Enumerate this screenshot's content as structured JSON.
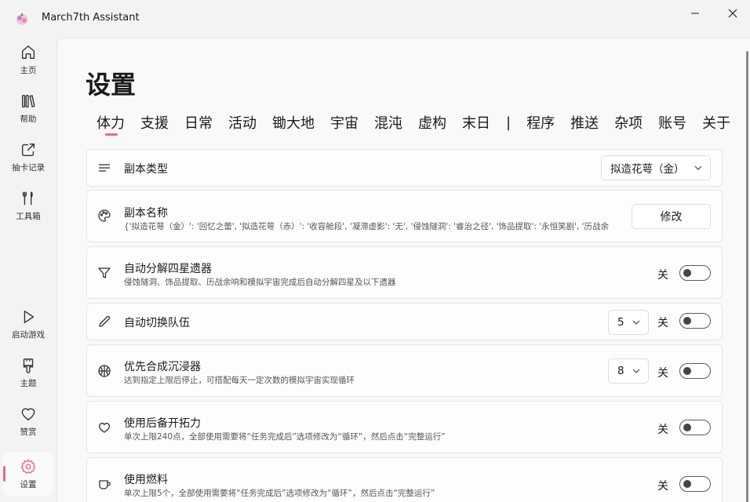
{
  "window": {
    "title": "March7th Assistant"
  },
  "sidebar": {
    "items": [
      {
        "label": "主页",
        "icon": "home-icon"
      },
      {
        "label": "帮助",
        "icon": "library-icon"
      },
      {
        "label": "抽卡记录",
        "icon": "share-icon"
      },
      {
        "label": "工具箱",
        "icon": "tools-icon"
      },
      {
        "label": "启动游戏",
        "icon": "play-icon"
      },
      {
        "label": "主题",
        "icon": "brush-icon"
      },
      {
        "label": "赞赏",
        "icon": "heart-icon"
      },
      {
        "label": "设置",
        "icon": "gear-icon",
        "active": true
      }
    ]
  },
  "page": {
    "title": "设置"
  },
  "tabs": [
    "体力",
    "支援",
    "日常",
    "活动",
    "锄大地",
    "宇宙",
    "混沌",
    "虚构",
    "末日",
    "|",
    "程序",
    "推送",
    "杂项",
    "账号",
    "关于"
  ],
  "cards": {
    "instance_type": {
      "title": "副本类型",
      "value": "拟造花萼（金）"
    },
    "instance_name": {
      "title": "副本名称",
      "desc": "{'拟造花萼（金）': '回忆之蕾', '拟造花萼（赤）': '收容舱段', '凝滞虚影': '无', '侵蚀隧洞': '睿治之径', '饰品提取': '永恒笑剧', '历战余",
      "button": "修改"
    },
    "auto_decompose": {
      "title": "自动分解四星遗器",
      "desc": "侵蚀隧洞、饰品提取、历战余响和模拟宇宙完成后自动分解四星及以下遗器",
      "state": "关"
    },
    "auto_team": {
      "title": "自动切换队伍",
      "value": "5",
      "state": "关"
    },
    "immersifier": {
      "title": "优先合成沉浸器",
      "desc": "达到指定上限后停止，可搭配每天一定次数的模拟宇宙实现循环",
      "value": "8",
      "state": "关"
    },
    "backup_power": {
      "title": "使用后备开拓力",
      "desc": "单次上限240点，全部使用需要将“任务完成后”选项修改为“循环”，然后点击“完整运行”",
      "state": "关"
    },
    "fuel": {
      "title": "使用燃料",
      "desc": "单次上限5个，全部使用需要将“任务完成后”选项修改为“循环”，然后点击“完整运行”",
      "state": "关"
    }
  },
  "colors": {
    "accent": "#e26c8b"
  }
}
